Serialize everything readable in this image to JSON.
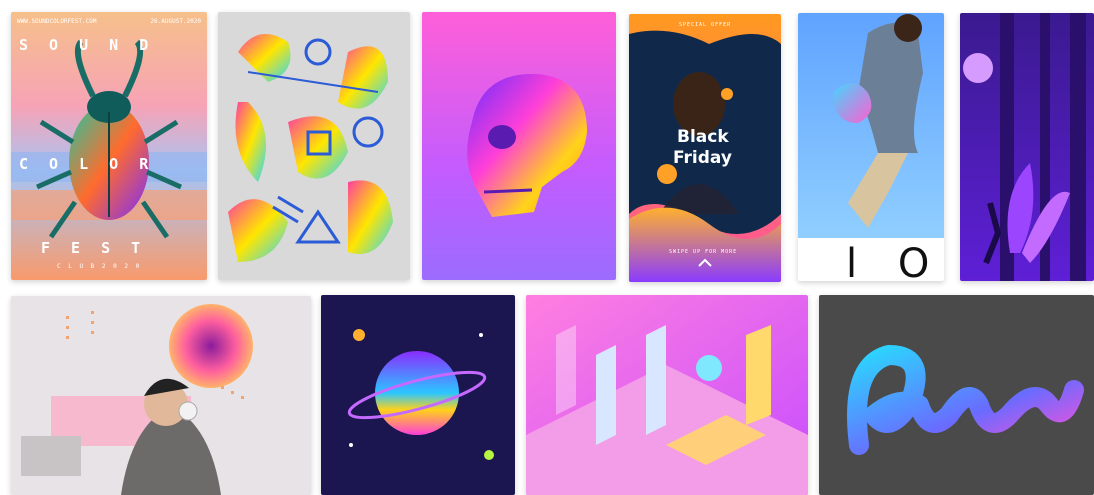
{
  "posters": [
    {
      "id": "sound-color-fest",
      "site": "WWW.SOUNDCOLORFEST.COM",
      "date": "26.AUGUST.2020",
      "word1": "S O U N D",
      "word2": "C O L O R",
      "word3": "F E S T",
      "sub": "C L U B   2 0 2 0"
    },
    {
      "id": "memphis-shapes"
    },
    {
      "id": "gradient-skull"
    },
    {
      "id": "black-friday",
      "top": "SPECIAL OFFER",
      "title_line1": "Black",
      "title_line2": "Friday",
      "bottom": "SWIPE UP FOR MORE"
    },
    {
      "id": "jumping-man",
      "letters": "l O"
    },
    {
      "id": "purple-forest"
    },
    {
      "id": "headphones-collage"
    },
    {
      "id": "space-planet"
    },
    {
      "id": "isometric-11-11"
    },
    {
      "id": "lettering-3d"
    }
  ],
  "colors": {
    "pink": "#ff3fd8",
    "purple": "#6a2cff",
    "cyan": "#29c6ff",
    "orange": "#ff9a1f",
    "dark_gray": "#4a4a4a"
  }
}
